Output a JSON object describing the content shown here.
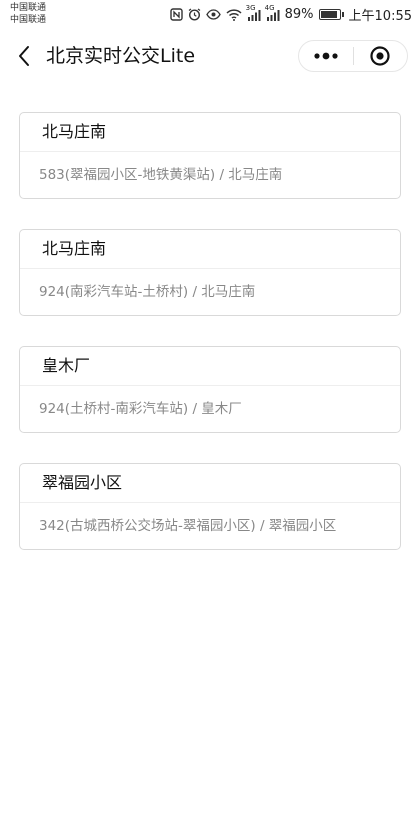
{
  "status_bar": {
    "carrier_1": "中国联通",
    "carrier_2": "中国联通",
    "network_1": "3G",
    "network_2": "4G",
    "battery_percent": "89%",
    "battery_level": 0.89,
    "time": "上午10:55"
  },
  "nav": {
    "title": "北京实时公交Lite"
  },
  "stops": [
    {
      "name": "北马庄南",
      "route": "583(翠福园小区-地铁黄渠站) / 北马庄南"
    },
    {
      "name": "北马庄南",
      "route": "924(南彩汽车站-土桥村) / 北马庄南"
    },
    {
      "name": "皇木厂",
      "route": "924(土桥村-南彩汽车站) / 皇木厂"
    },
    {
      "name": "翠福园小区",
      "route": "342(古城西桥公交场站-翠福园小区) / 翠福园小区"
    }
  ],
  "colors": {
    "card_border": "#d9d9d9",
    "subtitle_text": "#888888"
  },
  "icons": {
    "back": "chevron-left-icon",
    "more": "more-dots-icon",
    "close": "target-circle-icon"
  }
}
